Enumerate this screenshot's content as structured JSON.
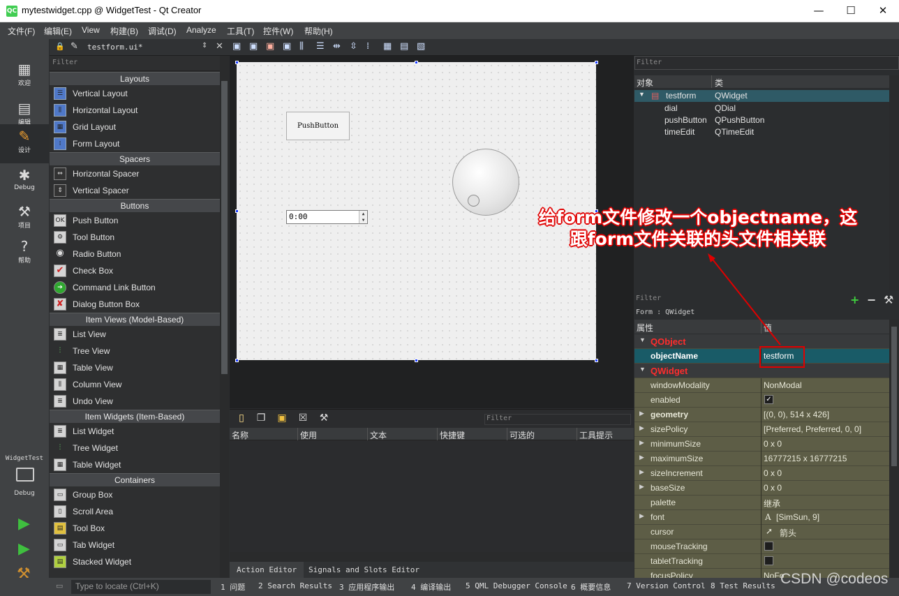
{
  "window": {
    "title": "mytestwidget.cpp @ WidgetTest - Qt Creator",
    "app_icon_text": "QC",
    "minimize": "—",
    "maximize": "☐",
    "close": "✕"
  },
  "menu": [
    "文件(F)",
    "编辑(E)",
    "View",
    "构建(B)",
    "调试(D)",
    "Analyze",
    "工具(T)",
    "控件(W)",
    "帮助(H)"
  ],
  "editor_tab": {
    "file": "testform.ui*"
  },
  "modes": [
    {
      "label": "欢迎",
      "icon": "welcome-grid-icon",
      "glyph": "▦"
    },
    {
      "label": "编辑",
      "icon": "edit-document-icon",
      "glyph": "▤"
    },
    {
      "label": "设计",
      "icon": "design-pencil-icon",
      "glyph": "✎"
    },
    {
      "label": "Debug",
      "icon": "debug-bug-icon",
      "glyph": "✱"
    },
    {
      "label": "项目",
      "icon": "project-wrench-icon",
      "glyph": "⚒"
    },
    {
      "label": "帮助",
      "icon": "help-icon",
      "glyph": "?"
    }
  ],
  "kit": {
    "project": "WidgetTest",
    "config": "Debug"
  },
  "widget_box": {
    "filter_placeholder": "Filter",
    "layouts_title": "Layouts",
    "layouts": [
      "Vertical Layout",
      "Horizontal Layout",
      "Grid Layout",
      "Form Layout"
    ],
    "spacers_title": "Spacers",
    "spacers": [
      "Horizontal Spacer",
      "Vertical Spacer"
    ],
    "buttons_title": "Buttons",
    "buttons": [
      "Push Button",
      "Tool Button",
      "Radio Button",
      "Check Box",
      "Command Link Button",
      "Dialog Button Box"
    ],
    "views_title": "Item Views (Model-Based)",
    "views": [
      "List View",
      "Tree View",
      "Table View",
      "Column View",
      "Undo View"
    ],
    "iwidgets_title": "Item Widgets (Item-Based)",
    "iwidgets": [
      "List Widget",
      "Tree Widget",
      "Table Widget"
    ],
    "containers_title": "Containers",
    "containers": [
      "Group Box",
      "Scroll Area",
      "Tool Box",
      "Tab Widget",
      "Stacked Widget"
    ]
  },
  "form": {
    "push_button_text": "PushButton",
    "time_edit_value": "0:00"
  },
  "action_editor": {
    "filter_placeholder": "Filter",
    "columns": [
      "名称",
      "使用",
      "文本",
      "快捷键",
      "可选的",
      "工具提示"
    ],
    "tabs": [
      "Action Editor",
      "Signals and Slots Editor"
    ]
  },
  "object_inspector": {
    "filter_placeholder": "Filter",
    "col_object": "对象",
    "col_class": "类",
    "rows": [
      {
        "name": "testform",
        "cls": "QWidget"
      },
      {
        "name": "dial",
        "cls": "QDial"
      },
      {
        "name": "pushButton",
        "cls": "QPushButton"
      },
      {
        "name": "timeEdit",
        "cls": "QTimeEdit"
      }
    ]
  },
  "property_editor": {
    "filter_placeholder": "Filter",
    "class_label": "Form : QWidget",
    "col_property": "属性",
    "col_value": "值",
    "group_qobject": "QObject",
    "object_name_label": "objectName",
    "object_name_value": "testform",
    "group_qwidget": "QWidget",
    "props": [
      {
        "name": "windowModality",
        "value": "NonModal"
      },
      {
        "name": "enabled",
        "value": "✓"
      },
      {
        "name": "geometry",
        "value": "[(0, 0), 514 x 426]"
      },
      {
        "name": "sizePolicy",
        "value": "[Preferred, Preferred, 0, 0]"
      },
      {
        "name": "minimumSize",
        "value": "0 x 0"
      },
      {
        "name": "maximumSize",
        "value": "16777215 x 16777215"
      },
      {
        "name": "sizeIncrement",
        "value": "0 x 0"
      },
      {
        "name": "baseSize",
        "value": "0 x 0"
      },
      {
        "name": "palette",
        "value": "继承"
      },
      {
        "name": "font",
        "value": "[SimSun, 9]"
      },
      {
        "name": "cursor",
        "value": "箭头"
      },
      {
        "name": "mouseTracking",
        "value": ""
      },
      {
        "name": "tabletTracking",
        "value": ""
      },
      {
        "name": "focusPolicy",
        "value": "NoFo"
      }
    ]
  },
  "statusbar": {
    "locate_placeholder": "Type to locate (Ctrl+K)",
    "tabs": [
      "1 问题",
      "2 Search Results",
      "3 应用程序输出",
      "4 编译输出",
      "5 QML Debugger Console",
      "6 概要信息",
      "7 Version Control",
      "8 Test Results"
    ]
  },
  "annotation": {
    "line1": "给form文件修改一个objectname，这",
    "line2": "跟form文件关联的头文件相关联"
  },
  "watermark": "CSDN @codeos",
  "colors": {
    "accent_red": "#e00000",
    "selection": "#195b67",
    "prop_row": "#5d5d46"
  }
}
